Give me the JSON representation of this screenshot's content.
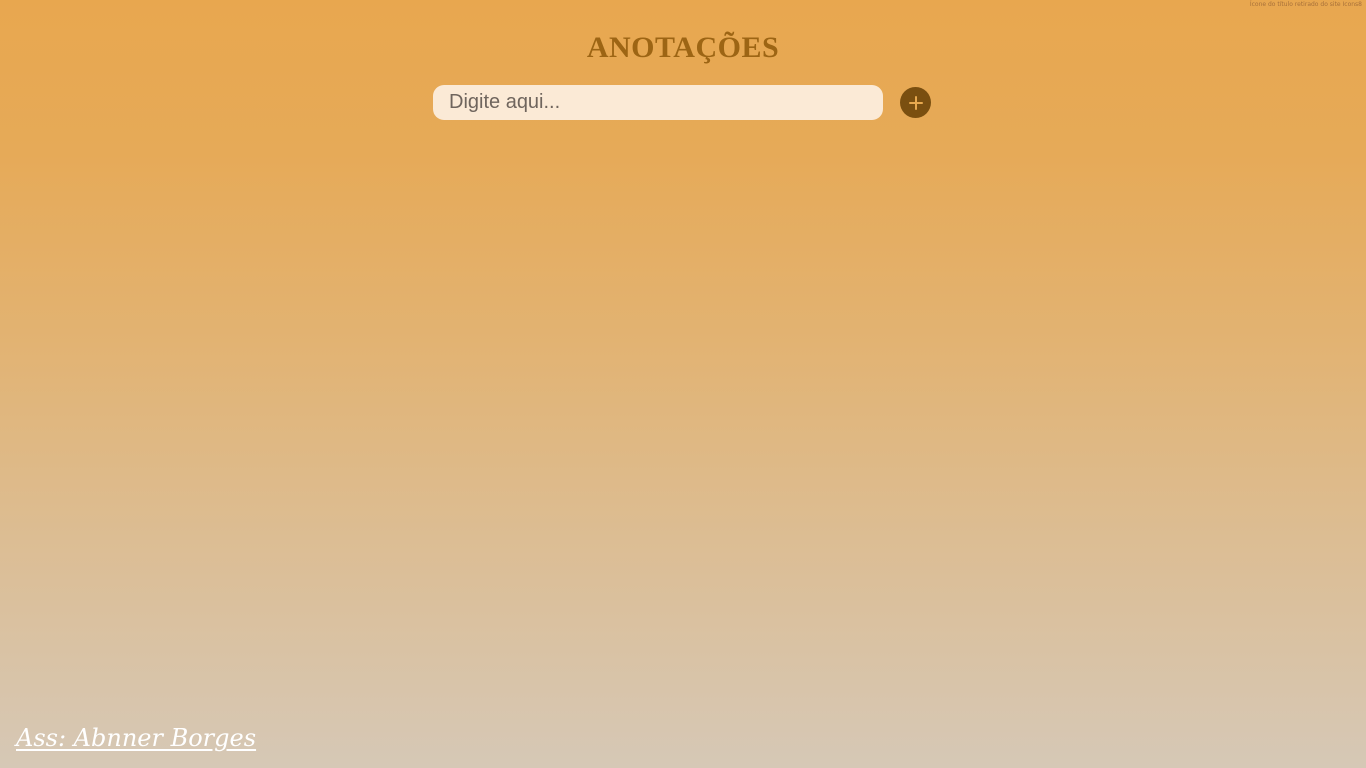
{
  "credit": {
    "text": "Ícone do título retirado do site Icons8"
  },
  "header": {
    "title": "ANOTAÇÕES"
  },
  "note_form": {
    "input_placeholder": "Digite aqui...",
    "input_value": "",
    "add_icon": "plus-icon"
  },
  "footer": {
    "signature": "Ass: Abnner Borges"
  },
  "colors": {
    "accent": "#7a4f10",
    "title": "#9d6514",
    "input_background": "#fbead6"
  }
}
